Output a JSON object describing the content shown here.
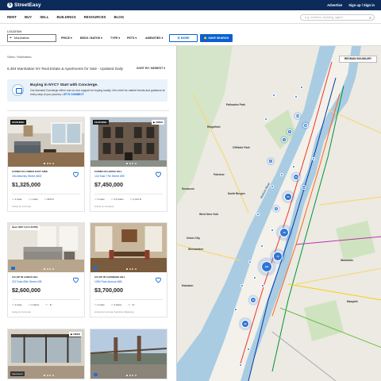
{
  "brand": {
    "name": "StreetEasy",
    "mark": "S"
  },
  "top_links": [
    "Advertise",
    "Sign up / Sign in"
  ],
  "nav": {
    "items": [
      "RENT",
      "BUY",
      "SELL",
      "BUILDINGS",
      "RESOURCES",
      "BLOG"
    ],
    "search_placeholder": "e.g. address, building, agent"
  },
  "filters": {
    "location_label": "LOCATION",
    "location_value": "Manhattan",
    "price": "PRICE",
    "beds_baths": "BEDS / BATHS",
    "type": "TYPE",
    "pets": "PETS",
    "amenities": "AMENITIES",
    "more": "MORE",
    "save_search": "SAVE SEARCH"
  },
  "results": {
    "breadcrumb": "Sales  /  Manhattan",
    "count_text": "6,364 Manhattan NY Real Estate & Apartments for Sale - Updated Daily",
    "sort_label": "SORT BY: NEWEST"
  },
  "promo": {
    "title": "Buying in NYC? Start with Concierge.",
    "body": "Our licensed Concierge offers one-on-one support for buying locally. Get a feel for market trends and guidance at every step of your journey.",
    "link": "LET'S CONNECT"
  },
  "listings": [
    {
      "badge": "FEATURED",
      "badge2": "",
      "open": "",
      "type": "CONDO IN LOWER EAST SIDE",
      "address": "154 Attorney Street #602",
      "price": "$1,325,000",
      "beds": "2 beds",
      "baths": "1 bath",
      "sqft": "965 ft²",
      "agent": "Listing by Corcoran"
    },
    {
      "badge": "FEATURED",
      "badge2": "VIDEO",
      "open": "",
      "type": "CONDO IN LENOX HILL",
      "address": "132 East 77th Street #9E",
      "price": "$7,450,000",
      "beds": "3 beds",
      "baths": "3.5 baths",
      "sqft": "2,413 ft²",
      "agent": "Listing by Compass"
    },
    {
      "badge": "",
      "badge2": "",
      "open": "Open SEP 4 (2-4:30 PM)",
      "type": "CO-OP IN LENOX HILL",
      "address": "222 East 65th Street #3E",
      "price": "$2,600,000",
      "beds": "3 beds",
      "baths": "2 baths",
      "sqft": "- ft²",
      "agent": "Listing by Corcoran"
    },
    {
      "badge": "",
      "badge2": "",
      "open": "",
      "type": "CO-OP IN CARNEGIE HILL",
      "address": "1050 Park Avenue #6B",
      "price": "$3,700,000",
      "beds": "4 beds",
      "baths": "3 baths",
      "sqft": "- ft²",
      "agent": "Listing by Corcoran Sunshine Marketing"
    },
    {
      "badge": "",
      "badge2": "VIDEO",
      "open": "",
      "sponsored": "Sponsored"
    },
    {
      "badge": "",
      "badge2": "",
      "open": ""
    }
  ],
  "map": {
    "button": "REDRAW BOUNDARY",
    "labels": [
      "Palisades Park",
      "Ridgefield",
      "Cliffside Park",
      "Fairview",
      "West New York",
      "Union City",
      "Weehawken",
      "Hoboken",
      "Secaucus",
      "North Bergen",
      "Woodside",
      "Maspeth"
    ],
    "water_labels": [
      "Hudson River"
    ],
    "clusters": [
      "20",
      "18",
      "8",
      "5",
      "9",
      "20",
      "12",
      "34",
      "8",
      "78",
      "72",
      "181",
      "13",
      "32"
    ]
  }
}
